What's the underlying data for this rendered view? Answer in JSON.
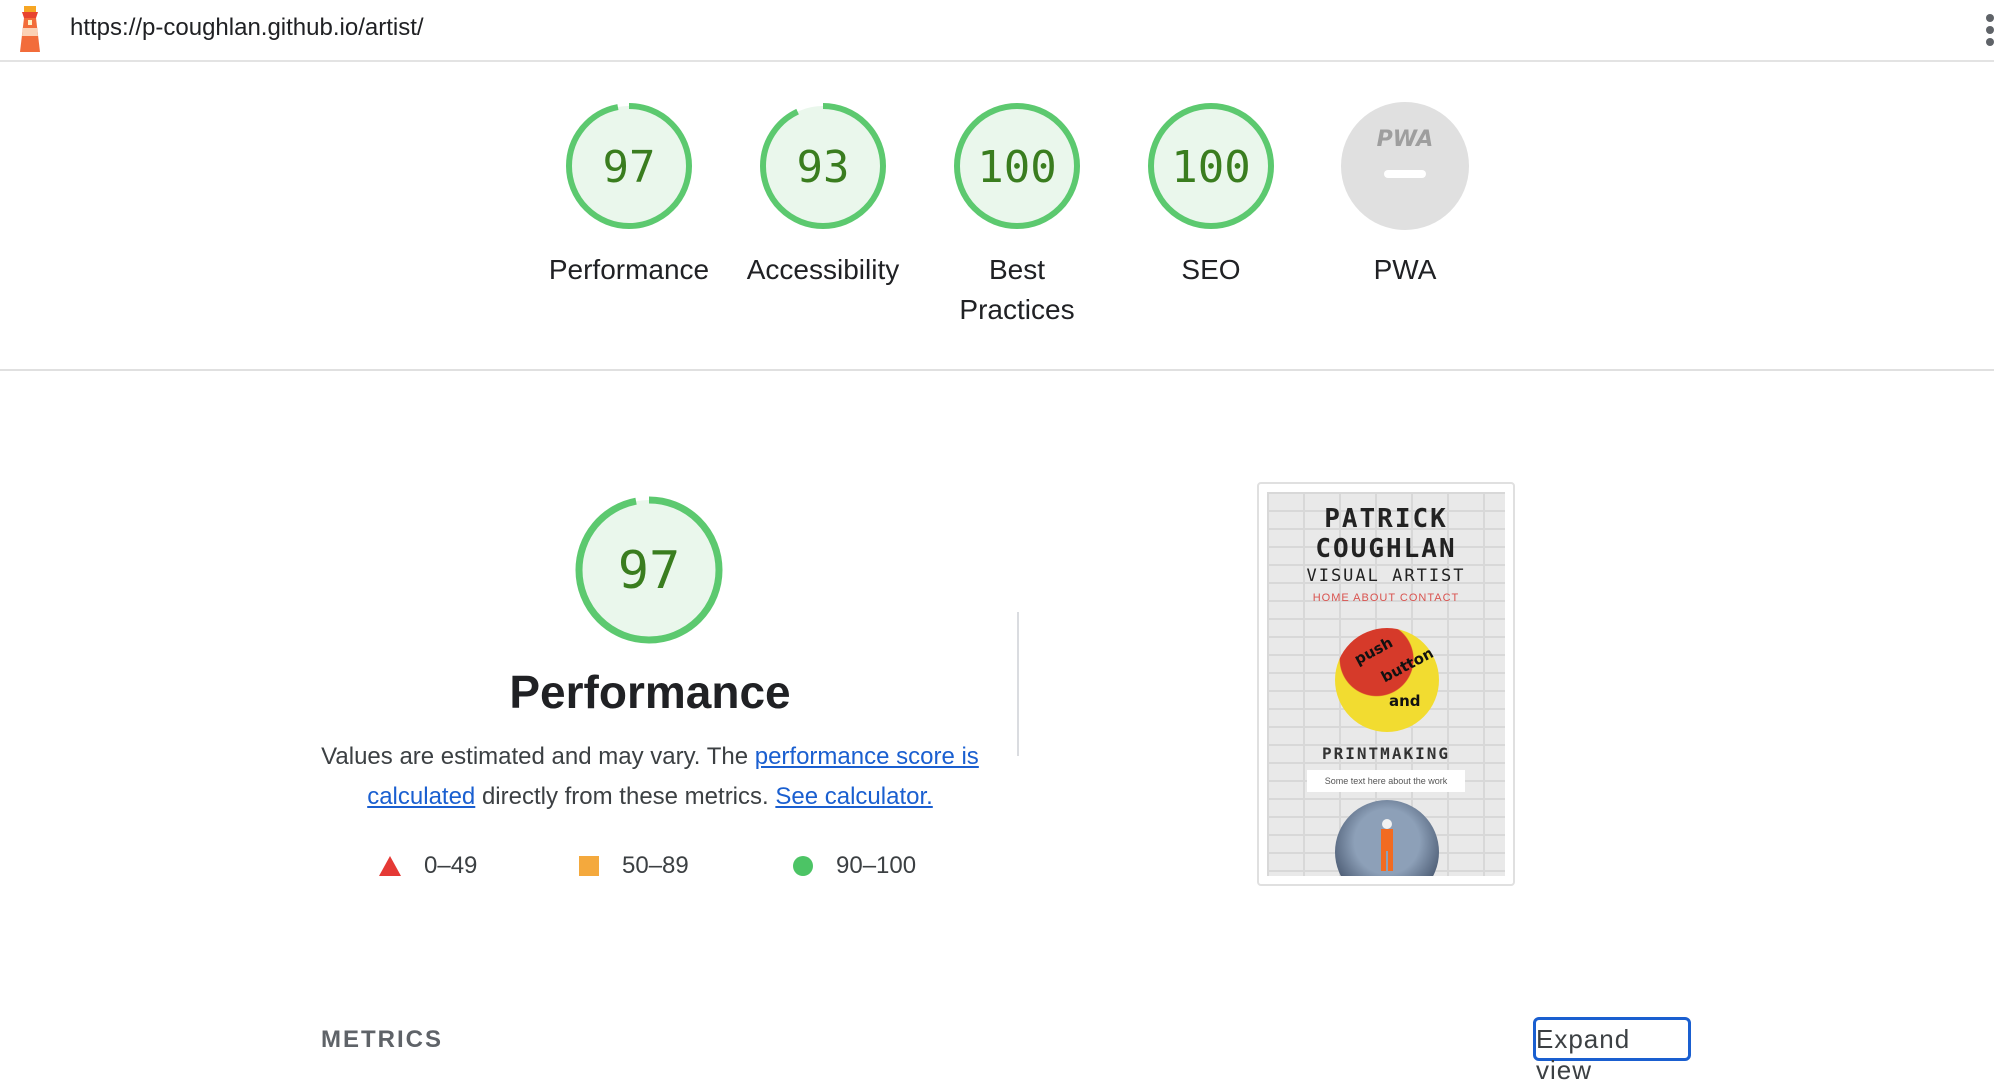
{
  "header": {
    "url": "https://p-coughlan.github.io/artist/"
  },
  "categories": [
    {
      "score": "97",
      "label_line1": "Performance",
      "label_line2": "",
      "fraction": 0.97
    },
    {
      "score": "93",
      "label_line1": "Accessibility",
      "label_line2": "",
      "fraction": 0.93
    },
    {
      "score": "100",
      "label_line1": "Best",
      "label_line2": "Practices",
      "fraction": 1.0
    },
    {
      "score": "100",
      "label_line1": "SEO",
      "label_line2": "",
      "fraction": 1.0
    },
    {
      "score": "",
      "label_line1": "PWA",
      "label_line2": "",
      "badge": "PWA"
    }
  ],
  "performance": {
    "score": "97",
    "fraction": 0.97,
    "title": "Performance",
    "desc_pre": "Values are estimated and may vary. The ",
    "desc_link1": "performance score is calculated",
    "desc_mid": " directly from these metrics. ",
    "desc_link2": "See calculator."
  },
  "legend": [
    {
      "shape": "triangle",
      "range": "0–49",
      "color": "#e53935"
    },
    {
      "shape": "square",
      "range": "50–89",
      "color": "#f4a93d"
    },
    {
      "shape": "circle",
      "range": "90–100",
      "color": "#4cc465"
    }
  ],
  "thumbnail": {
    "name_line1": "PATRICK",
    "name_line2": "COUGHLAN",
    "subtitle": "VISUAL ARTIST",
    "nav": "HOME   ABOUT   CONTACT",
    "sign_words": [
      "push",
      "button",
      "and"
    ],
    "section": "PRINTMAKING",
    "caption": "Some text here about the work"
  },
  "metrics": {
    "label": "METRICS",
    "expand_button": "Expand view"
  },
  "colors": {
    "pass_ring": "#5cc96f",
    "pass_fill": "#eaf7ec",
    "pass_text": "#3a7d1f",
    "pwa_fill": "#e0e0e0",
    "link": "#1a5fd0"
  }
}
